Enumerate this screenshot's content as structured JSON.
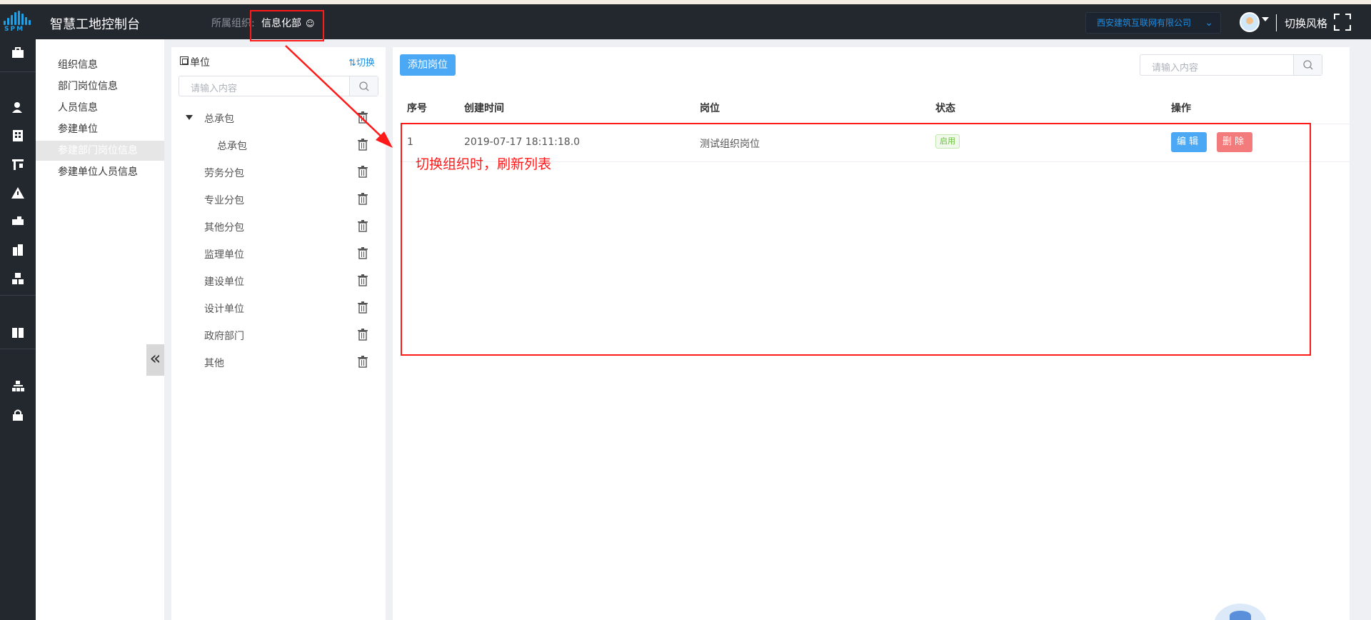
{
  "header": {
    "app_title": "智慧工地控制台",
    "org_label": "所属组织:",
    "org_value": "信息化部",
    "company": "西安建筑互联网有限公司",
    "switch_style": "切换风格",
    "logo_text": "SPM"
  },
  "nav": {
    "items": [
      "组织信息",
      "部门岗位信息",
      "人员信息",
      "参建单位",
      "参建部门岗位信息",
      "参建单位人员信息"
    ],
    "active_index": 4,
    "collapse": "«"
  },
  "tree": {
    "title": "单位",
    "switch": "⇅切换",
    "search_placeholder": "请输入内容",
    "nodes": [
      "总承包",
      "总承包",
      "劳务分包",
      "专业分包",
      "其他分包",
      "监理单位",
      "建设单位",
      "设计单位",
      "政府部门",
      "其他"
    ]
  },
  "main": {
    "add_button": "添加岗位",
    "search_placeholder": "请输入内容",
    "columns": [
      "序号",
      "创建时间",
      "岗位",
      "状态",
      "操作"
    ],
    "rows": [
      {
        "index": "1",
        "created": "2019-07-17 18:11:18.0",
        "position": "测试组织岗位",
        "status": "启用",
        "edit": "编辑",
        "delete": "删除"
      }
    ]
  },
  "annotation": {
    "text": "切换组织时，刷新列表",
    "color": "#ff1a1a"
  },
  "colors": {
    "topbar": "#23272e",
    "primary": "#4aa8f5",
    "danger": "#f37b7b",
    "success": "#67c23a"
  }
}
